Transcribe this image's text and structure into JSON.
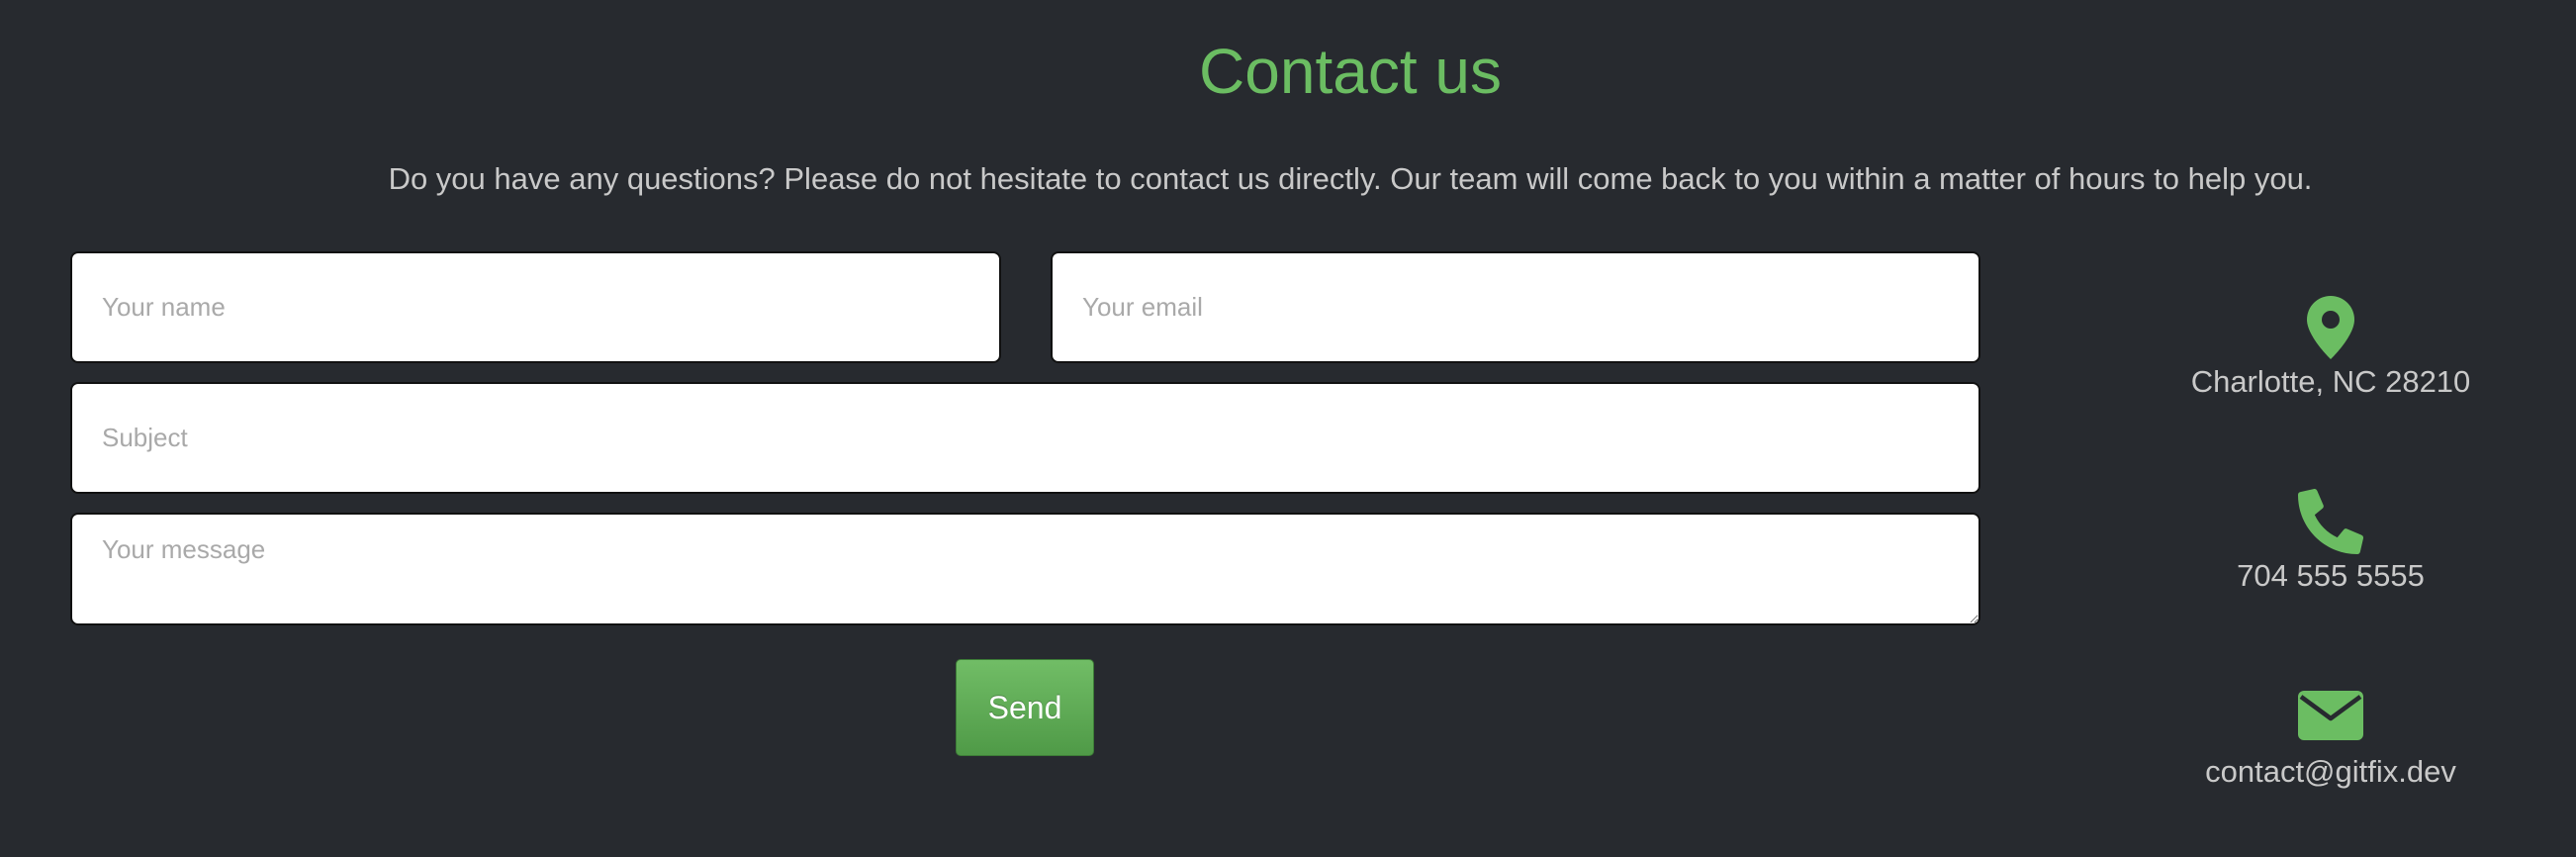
{
  "heading": {
    "title": "Contact us",
    "subtitle": "Do you have any questions? Please do not hesitate to contact us directly. Our team will come back to you within a matter of hours to help you."
  },
  "form": {
    "name_placeholder": "Your name",
    "email_placeholder": "Your email",
    "subject_placeholder": "Subject",
    "message_placeholder": "Your message",
    "send_label": "Send"
  },
  "contact_info": {
    "address": "Charlotte, NC 28210",
    "phone": "704 555 5555",
    "email": "contact@gitfix.dev"
  },
  "icons": {
    "address": "map-marker-icon",
    "phone": "phone-icon",
    "email": "envelope-icon"
  },
  "colors": {
    "background": "#272a2f",
    "accent": "#6bbd62",
    "text": "#c9c9c9"
  }
}
